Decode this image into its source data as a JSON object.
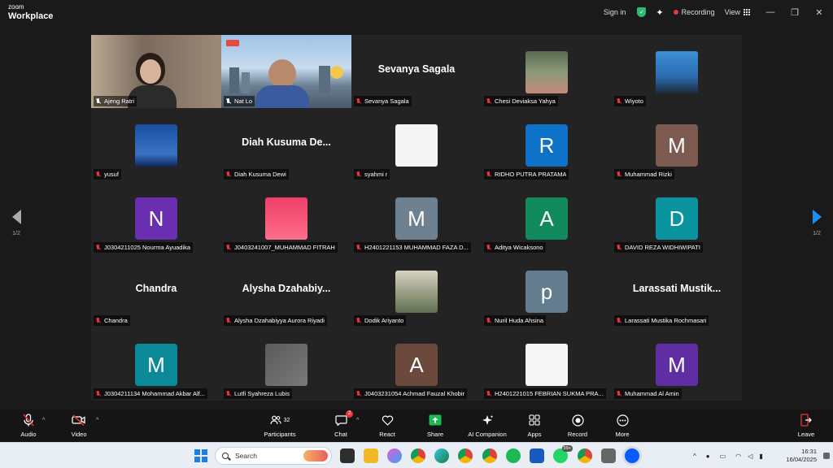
{
  "app": {
    "brand_small": "zoom",
    "brand_main": "Workplace"
  },
  "titlebar": {
    "sign_in": "Sign in",
    "recording": "Recording",
    "view": "View",
    "recording_color": "#e8363d",
    "shield_color": "#2eb872"
  },
  "pager": {
    "left": "1/2",
    "right": "1/2"
  },
  "participants": [
    {
      "label": "Ajeng Ratri",
      "kind": "video",
      "pinned": true,
      "active": true
    },
    {
      "label": "Nat Lo",
      "kind": "video",
      "pinned": true
    },
    {
      "label": "Sevanya Sagala",
      "kind": "name",
      "display": "Sevanya Sagala"
    },
    {
      "label": "Chesi Deviaksa Yahya",
      "kind": "photo"
    },
    {
      "label": "Wiyoto",
      "kind": "photo"
    },
    {
      "label": "yusuf",
      "kind": "photo"
    },
    {
      "label": "Diah Kusuma Dewi",
      "kind": "name",
      "display": "Diah Kusuma De..."
    },
    {
      "label": "syahmi r",
      "kind": "photo"
    },
    {
      "label": "RIDHO PUTRA PRATAMA",
      "kind": "avatar",
      "initial": "R",
      "color": "#0e72c9"
    },
    {
      "label": "Muhammad Rizki",
      "kind": "avatar",
      "initial": "M",
      "color": "#7d5a50"
    },
    {
      "label": "J0304211025 Nourma Ayuadika",
      "kind": "avatar",
      "initial": "N",
      "color": "#6a2fb0"
    },
    {
      "label": "J0403241007_MUHAMMAD FITRAH",
      "kind": "photo"
    },
    {
      "label": "H2401221153 MUHAMMAD FAZA D...",
      "kind": "avatar",
      "initial": "M",
      "color": "#6e8190"
    },
    {
      "label": "Aditya Wicaksono",
      "kind": "avatar",
      "initial": "A",
      "color": "#118a5e"
    },
    {
      "label": "DAVID REZA WIDHIWIPATI",
      "kind": "avatar",
      "initial": "D",
      "color": "#0a94a0"
    },
    {
      "label": "Chandra",
      "kind": "name",
      "display": "Chandra"
    },
    {
      "label": "Alysha Dzahabiyya Aurora Riyadi",
      "kind": "name",
      "display": "Alysha  Dzahabiy..."
    },
    {
      "label": "Dodik Ariyanto",
      "kind": "photo"
    },
    {
      "label": "Nuril Huda Ahsina",
      "kind": "avatar",
      "initial": "p",
      "color": "#647d8e"
    },
    {
      "label": "Larassati Mustika Rochmasari",
      "kind": "name",
      "display": "Larassati  Mustik..."
    },
    {
      "label": "J0304211134 Mohammad Akbar Alf...",
      "kind": "avatar",
      "initial": "M",
      "color": "#0a8a96"
    },
    {
      "label": "Lutfi Syahreza Lubis",
      "kind": "photo"
    },
    {
      "label": "J0403231054 Achmad Fauzal Khobir",
      "kind": "avatar",
      "initial": "A",
      "color": "#6b4a3d"
    },
    {
      "label": "H2401221015 FEBRIAN SUKMA PRA...",
      "kind": "photo"
    },
    {
      "label": "Muhammad Al Amin",
      "kind": "avatar",
      "initial": "M",
      "color": "#5f2ea3"
    }
  ],
  "toolbar": {
    "audio": "Audio",
    "video": "Video",
    "participants": "Participants",
    "participants_count": "32",
    "chat": "Chat",
    "chat_badge": "2",
    "react": "React",
    "share": "Share",
    "ai_companion": "AI Companion",
    "apps": "Apps",
    "record": "Record",
    "more": "More",
    "leave": "Leave"
  },
  "taskbar": {
    "search_placeholder": "Search",
    "whatsapp_badge": "99+",
    "time": "16:31",
    "date": "16/04/2025"
  }
}
